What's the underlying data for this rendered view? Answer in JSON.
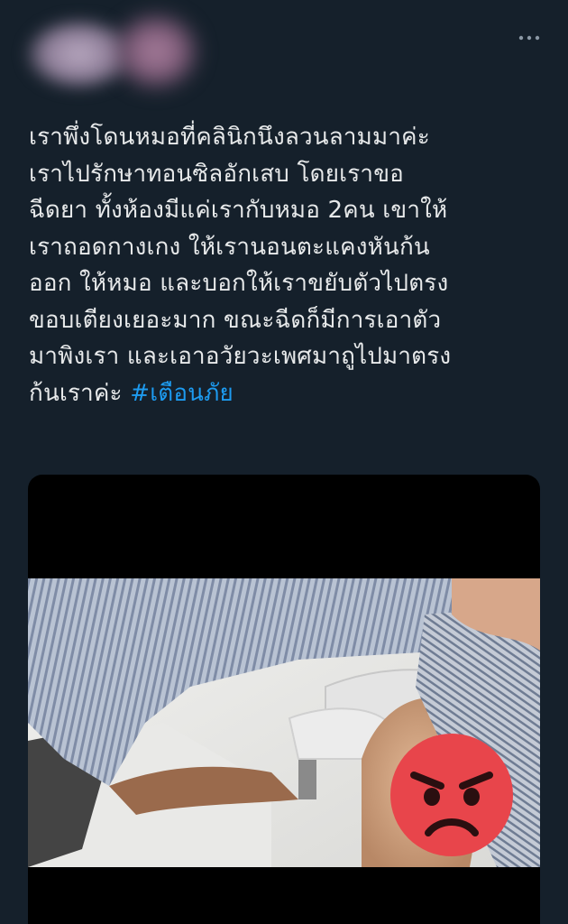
{
  "tweet": {
    "avatar_blurred": true,
    "more_icon": "more-horizontal-icon",
    "text_lines": [
      "เราพึ่งโดนหมอที่คลินิกนึงลวนลามมาค่ะ",
      "เราไปรักษาทอนซิลอักเสบ โดยเราขอ",
      "ฉีดยา ทั้งห้องมีแค่เรากับหมอ 2คน เขาให้",
      "เราถอดกางเกง ให้เรานอนตะแคงหันก้น",
      "ออก ให้หมอ และบอกให้เราขยับตัวไปตรง",
      "ขอบเตียงเยอะมาก ขณะฉีดก็มีการเอาตัว",
      "มาพิงเรา และเอาอวัยวะเพศมาถูไปมาตรง"
    ],
    "last_line_text": "ก้นเราค่ะ ",
    "hashtag": "#เตือนภัย",
    "colors": {
      "background": "#15202b",
      "text": "#e7e9ea",
      "link": "#1d9bf0"
    }
  },
  "media": {
    "overlay_icon": "angry-face-icon"
  }
}
